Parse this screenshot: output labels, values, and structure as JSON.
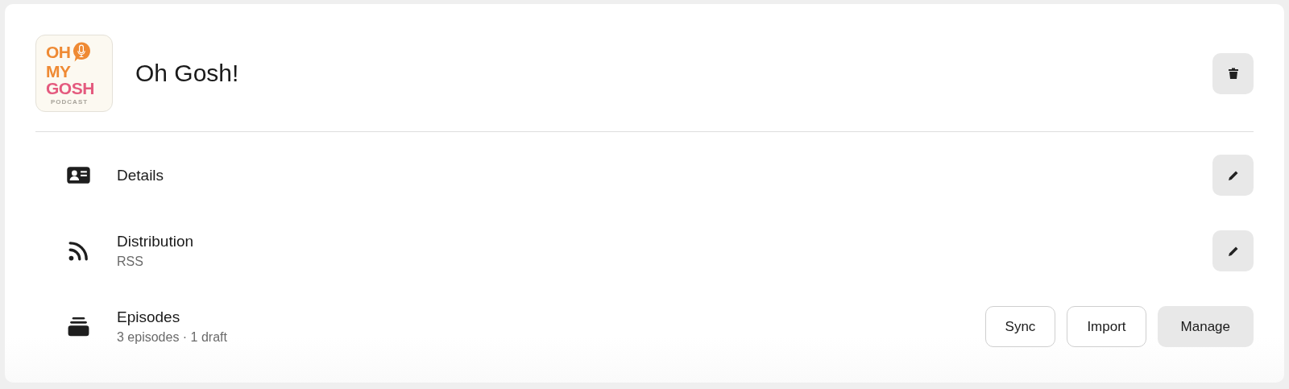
{
  "podcast": {
    "cover": {
      "lines": [
        "OH",
        "MY",
        "GOSH",
        "PODCAST"
      ]
    },
    "title": "Oh Gosh!"
  },
  "sections": [
    {
      "title": "Details",
      "kind": "edit"
    },
    {
      "title": "Distribution",
      "subtitle": "RSS",
      "kind": "edit"
    },
    {
      "title": "Episodes",
      "subtitle": "3 episodes · 1 draft",
      "kind": "actions",
      "buttons": [
        {
          "label": "Sync",
          "kind": "outline"
        },
        {
          "label": "Import",
          "kind": "outline"
        },
        {
          "label": "Manage",
          "kind": "filled"
        }
      ]
    }
  ]
}
